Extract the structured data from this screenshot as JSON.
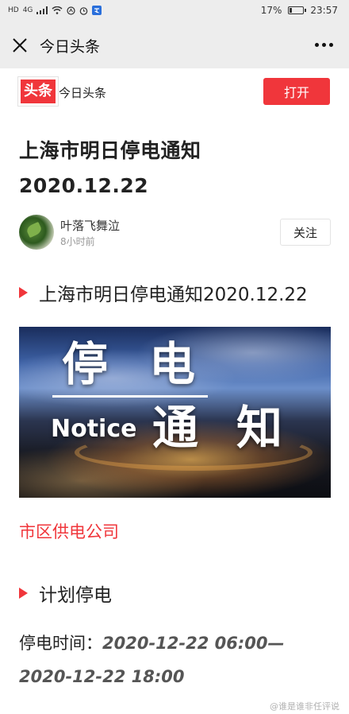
{
  "status_bar": {
    "left_labels": [
      "HD",
      "4G"
    ],
    "battery_text": "17%",
    "battery_level": 0.17,
    "time": "23:57"
  },
  "nav": {
    "title": "今日头条"
  },
  "app_banner": {
    "logo_text": "头条",
    "app_name": "今日头条",
    "open_label": "打开"
  },
  "article": {
    "title_line1": "上海市明日停电通知",
    "title_line2": "2020.12.22",
    "author_name": "叶落飞舞泣",
    "author_time": "8小时前",
    "follow_label": "关注",
    "section1": "上海市明日停电通知2020.12.22",
    "image": {
      "big_char_1": "停",
      "big_char_2": "电",
      "big_char_3": "通",
      "big_char_4": "知",
      "notice_word": "Notice"
    },
    "company": "市区供电公司",
    "section2": "计划停电",
    "time_label": "停电时间：",
    "time_value_1": "2020-12-22 06:00—",
    "time_value_2": "2020-12-22 18:00"
  },
  "watermark": "@谁是谁非任评说",
  "colors": {
    "accent": "#f0363b",
    "bar_bg": "#ededed"
  }
}
